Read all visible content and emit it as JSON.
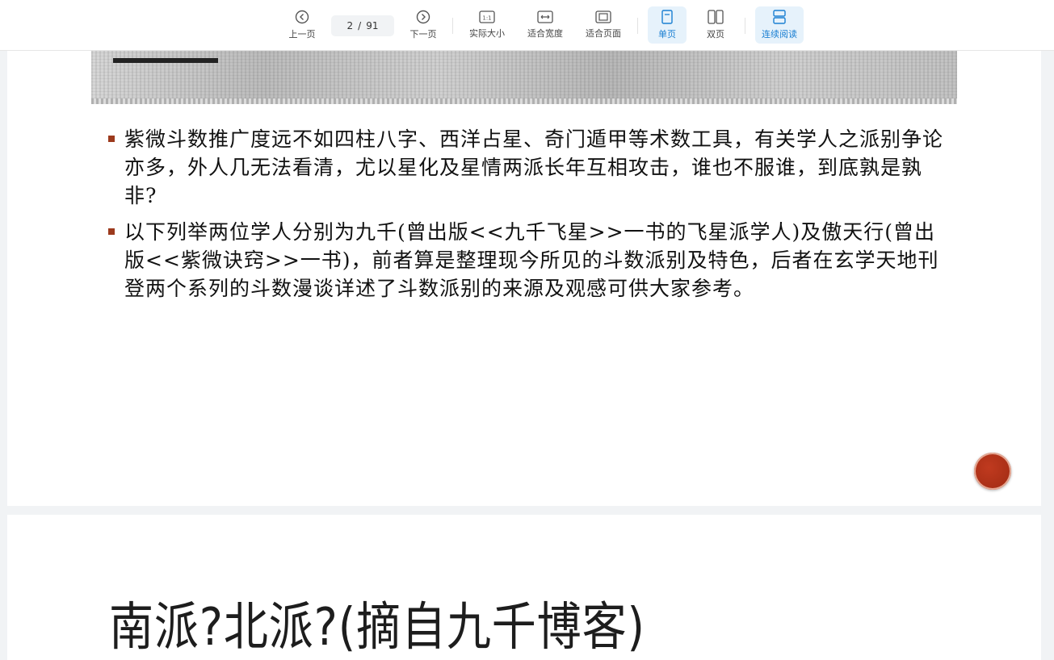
{
  "toolbar": {
    "prev_label": "上一页",
    "next_label": "下一页",
    "page_current": "2",
    "page_sep": "/",
    "page_total": "91",
    "actual_size_label": "实际大小",
    "fit_width_label": "适合宽度",
    "fit_page_label": "适合页面",
    "single_label": "单页",
    "double_label": "双页",
    "continuous_label": "连续阅读",
    "actual_size_icon_text": "1:1"
  },
  "page1": {
    "bullets": [
      "紫微斗数推广度远不如四柱八字、西洋占星、奇门遁甲等术数工具，有关学人之派别争论亦多，外人几无法看清，尤以星化及星情两派长年互相攻击，谁也不服谁，到底孰是孰非?",
      "以下列举两位学人分别为九千(曾出版<<九千飞星>>一书的飞星派学人)及傲天行(曾出版<<紫微诀窍>>一书)，前者算是整理现今所见的斗数派别及特色，后者在玄学天地刊登两个系列的斗数漫谈详述了斗数派别的来源及观感可供大家参考。"
    ]
  },
  "page2": {
    "title": "南派?北派?(摘自九千博客)"
  },
  "colors": {
    "accent": "#1a7fd2",
    "bullet": "#9c3a1d",
    "badge": "#b0321a"
  }
}
